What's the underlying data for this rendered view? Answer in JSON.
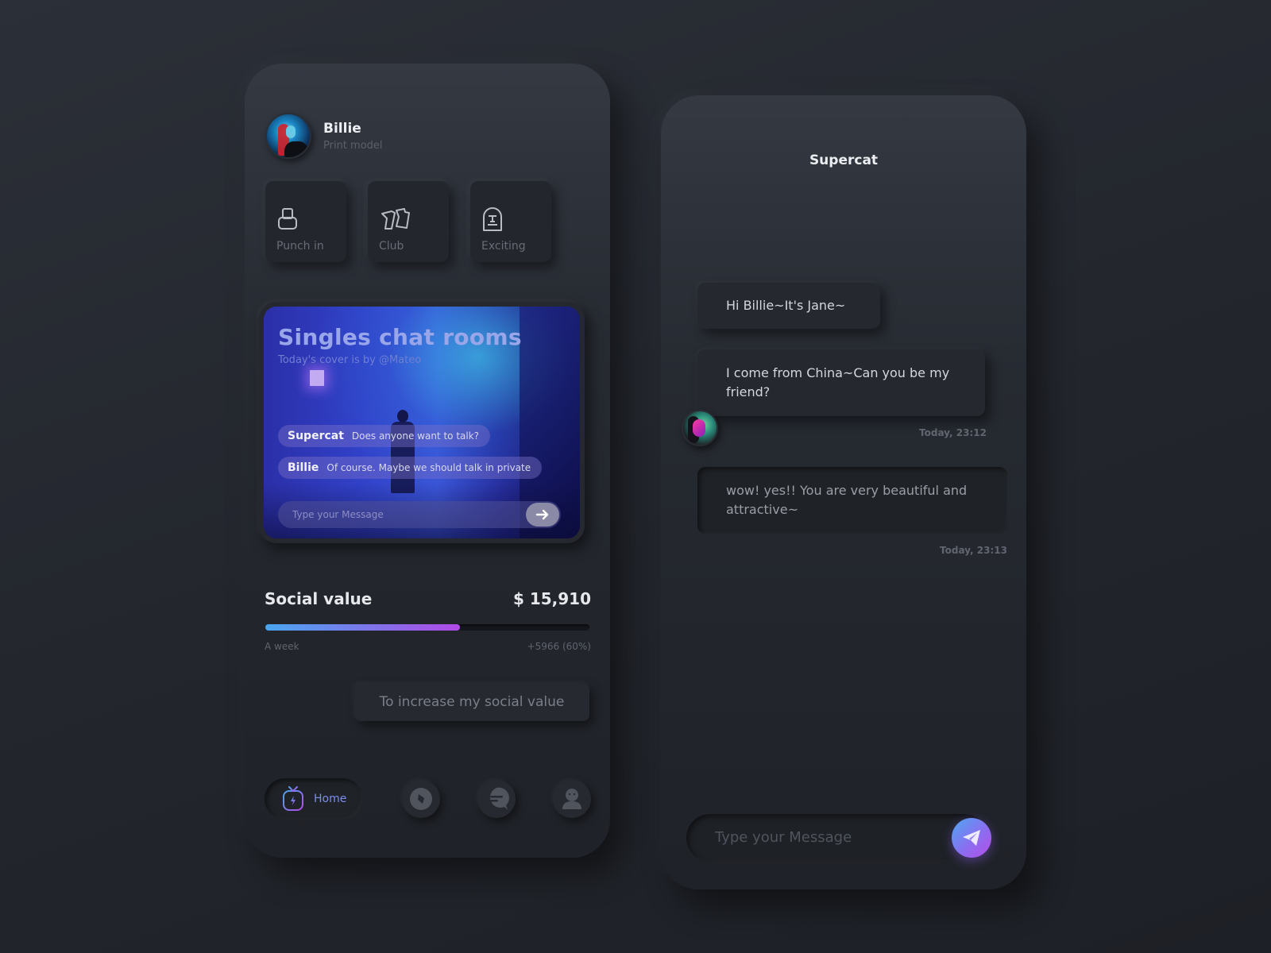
{
  "profile": {
    "name": "Billie",
    "role": "Print model"
  },
  "tiles": [
    {
      "label": "Punch in",
      "icon": "stamp-icon"
    },
    {
      "label": "Club",
      "icon": "cards-icon"
    },
    {
      "label": "Exciting",
      "icon": "tombstone-icon"
    }
  ],
  "room": {
    "title": "Singles chat rooms",
    "subtitle": "Today's cover is by @Mateo",
    "messages": [
      {
        "sender": "Supercat",
        "text": "Does anyone want to talk?"
      },
      {
        "sender": "Billie",
        "text": "Of course. Maybe we should talk in private"
      }
    ],
    "input_placeholder": "Type your Message",
    "send_icon": "arrow-right-icon"
  },
  "social_value": {
    "title": "Social value",
    "amount": "$ 15,910",
    "period": "A week",
    "change": "+5966 (60%)",
    "progress_percent": 60,
    "button_label": "To increase my social value",
    "gradient_colors": [
      "#4aa6f0",
      "#b14ae6"
    ]
  },
  "nav": {
    "items": [
      {
        "label": "Home",
        "icon": "tv-bolt-icon",
        "active": true
      },
      {
        "label": "",
        "icon": "compass-icon",
        "active": false
      },
      {
        "label": "",
        "icon": "message-icon",
        "active": false
      },
      {
        "label": "",
        "icon": "person-icon",
        "active": false
      }
    ],
    "accent": "#7d8cf0"
  },
  "chat": {
    "title": "Supercat",
    "messages": [
      {
        "text": "Hi Billie~It's Jane~",
        "time": ""
      },
      {
        "text": "I come from China~Can you be my friend?",
        "time": "Today, 23:12"
      },
      {
        "text": "wow! yes!! You are very beautiful and attractive~",
        "time": "Today, 23:13"
      }
    ],
    "input_placeholder": "Type your Message",
    "send_icon": "paper-plane-icon"
  }
}
